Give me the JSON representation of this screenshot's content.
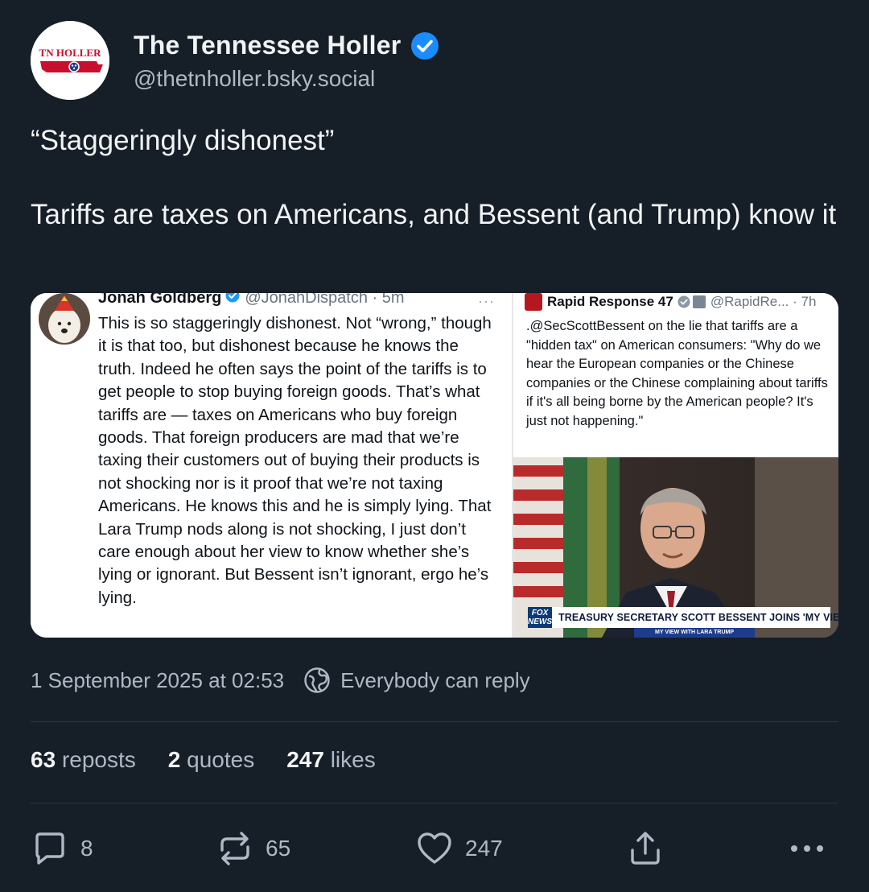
{
  "author": {
    "display_name": "The Tennessee Holler",
    "handle": "@thetnholler.bsky.social",
    "avatar_text": "TN HOLLER"
  },
  "post": {
    "line1": "“Staggeringly dishonest”",
    "line2": "Tariffs are taxes on Americans, and Bessent (and Trump) know it"
  },
  "embedded_left": {
    "name": "Jonah Goldberg",
    "handle_time": "@JonahDispatch · 5m",
    "more": "···",
    "body": "This is so staggeringly dishonest. Not “wrong,” though it is that too, but dishonest because he knows the truth. Indeed he often says the point of the tariffs is to get people to stop buying foreign goods. That’s what tariffs are — taxes on Americans who buy foreign goods. That foreign producers are mad that we’re taxing their customers out of buying their products is not shocking nor is it proof that we’re not taxing Americans. He knows this and he is simply lying. That Lara Trump nods along is not shocking, I just don’t care enough about her view to know whether  she’s lying or ignorant. But Bessent isn’t ignorant, ergo he’s lying."
  },
  "embedded_right": {
    "name": "Rapid Response 47",
    "handle_time": "@RapidRe... · 7h",
    "body": ".@SecScottBessent on the lie that tariffs are a \"hidden tax\" on American consumers: \"Why do we hear the European companies or the Chinese companies or the Chinese complaining about tariffs if it's all being borne by the American people? It's just not happening.\"",
    "chyron": "TREASURY SECRETARY SCOTT BESSENT JOINS 'MY VIEW'",
    "chyron_logo": "FOX NEWS",
    "chyron_sub": "MY VIEW WITH LARA TRUMP"
  },
  "meta": {
    "timestamp": "1 September 2025 at 02:53",
    "reply_setting": "Everybody can reply"
  },
  "stats": {
    "reposts_count": "63",
    "reposts_label": "reposts",
    "quotes_count": "2",
    "quotes_label": "quotes",
    "likes_count": "247",
    "likes_label": "likes"
  },
  "actions": {
    "reply_count": "8",
    "repost_count": "65",
    "like_count": "247"
  },
  "colors": {
    "background": "#161e27",
    "accent_blue": "#1a8cff",
    "muted_text": "#aeb9c5"
  }
}
